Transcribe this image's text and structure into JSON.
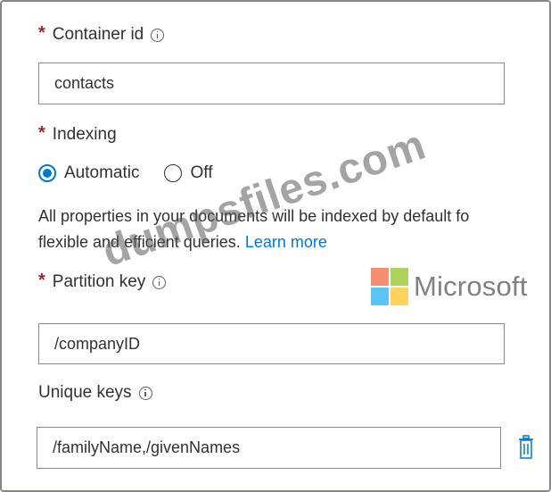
{
  "form": {
    "container_id": {
      "label": "Container id",
      "required_marker": "*",
      "value": "contacts"
    },
    "indexing": {
      "label": "Indexing",
      "required_marker": "*",
      "options": [
        "Automatic",
        "Off"
      ],
      "selected": "Automatic",
      "description_line1": "All properties in your documents will be indexed by default fo",
      "description_line2": "flexible and efficient queries. ",
      "learn_more": "Learn more"
    },
    "partition_key": {
      "label": "Partition key",
      "required_marker": "*",
      "value": "/companyID"
    },
    "unique_keys": {
      "label": "Unique keys",
      "value": "/familyName,/givenNames"
    }
  },
  "overlay": {
    "watermark": "dumpsfiles.com",
    "logo_text": "Microsoft",
    "logo_colors": [
      "#f25022",
      "#7fba00",
      "#00a4ef",
      "#ffb900"
    ]
  },
  "colors": {
    "accent": "#0078d4",
    "required": "#a4262c"
  },
  "icons": {
    "info": "info-icon",
    "delete": "trash-icon"
  }
}
